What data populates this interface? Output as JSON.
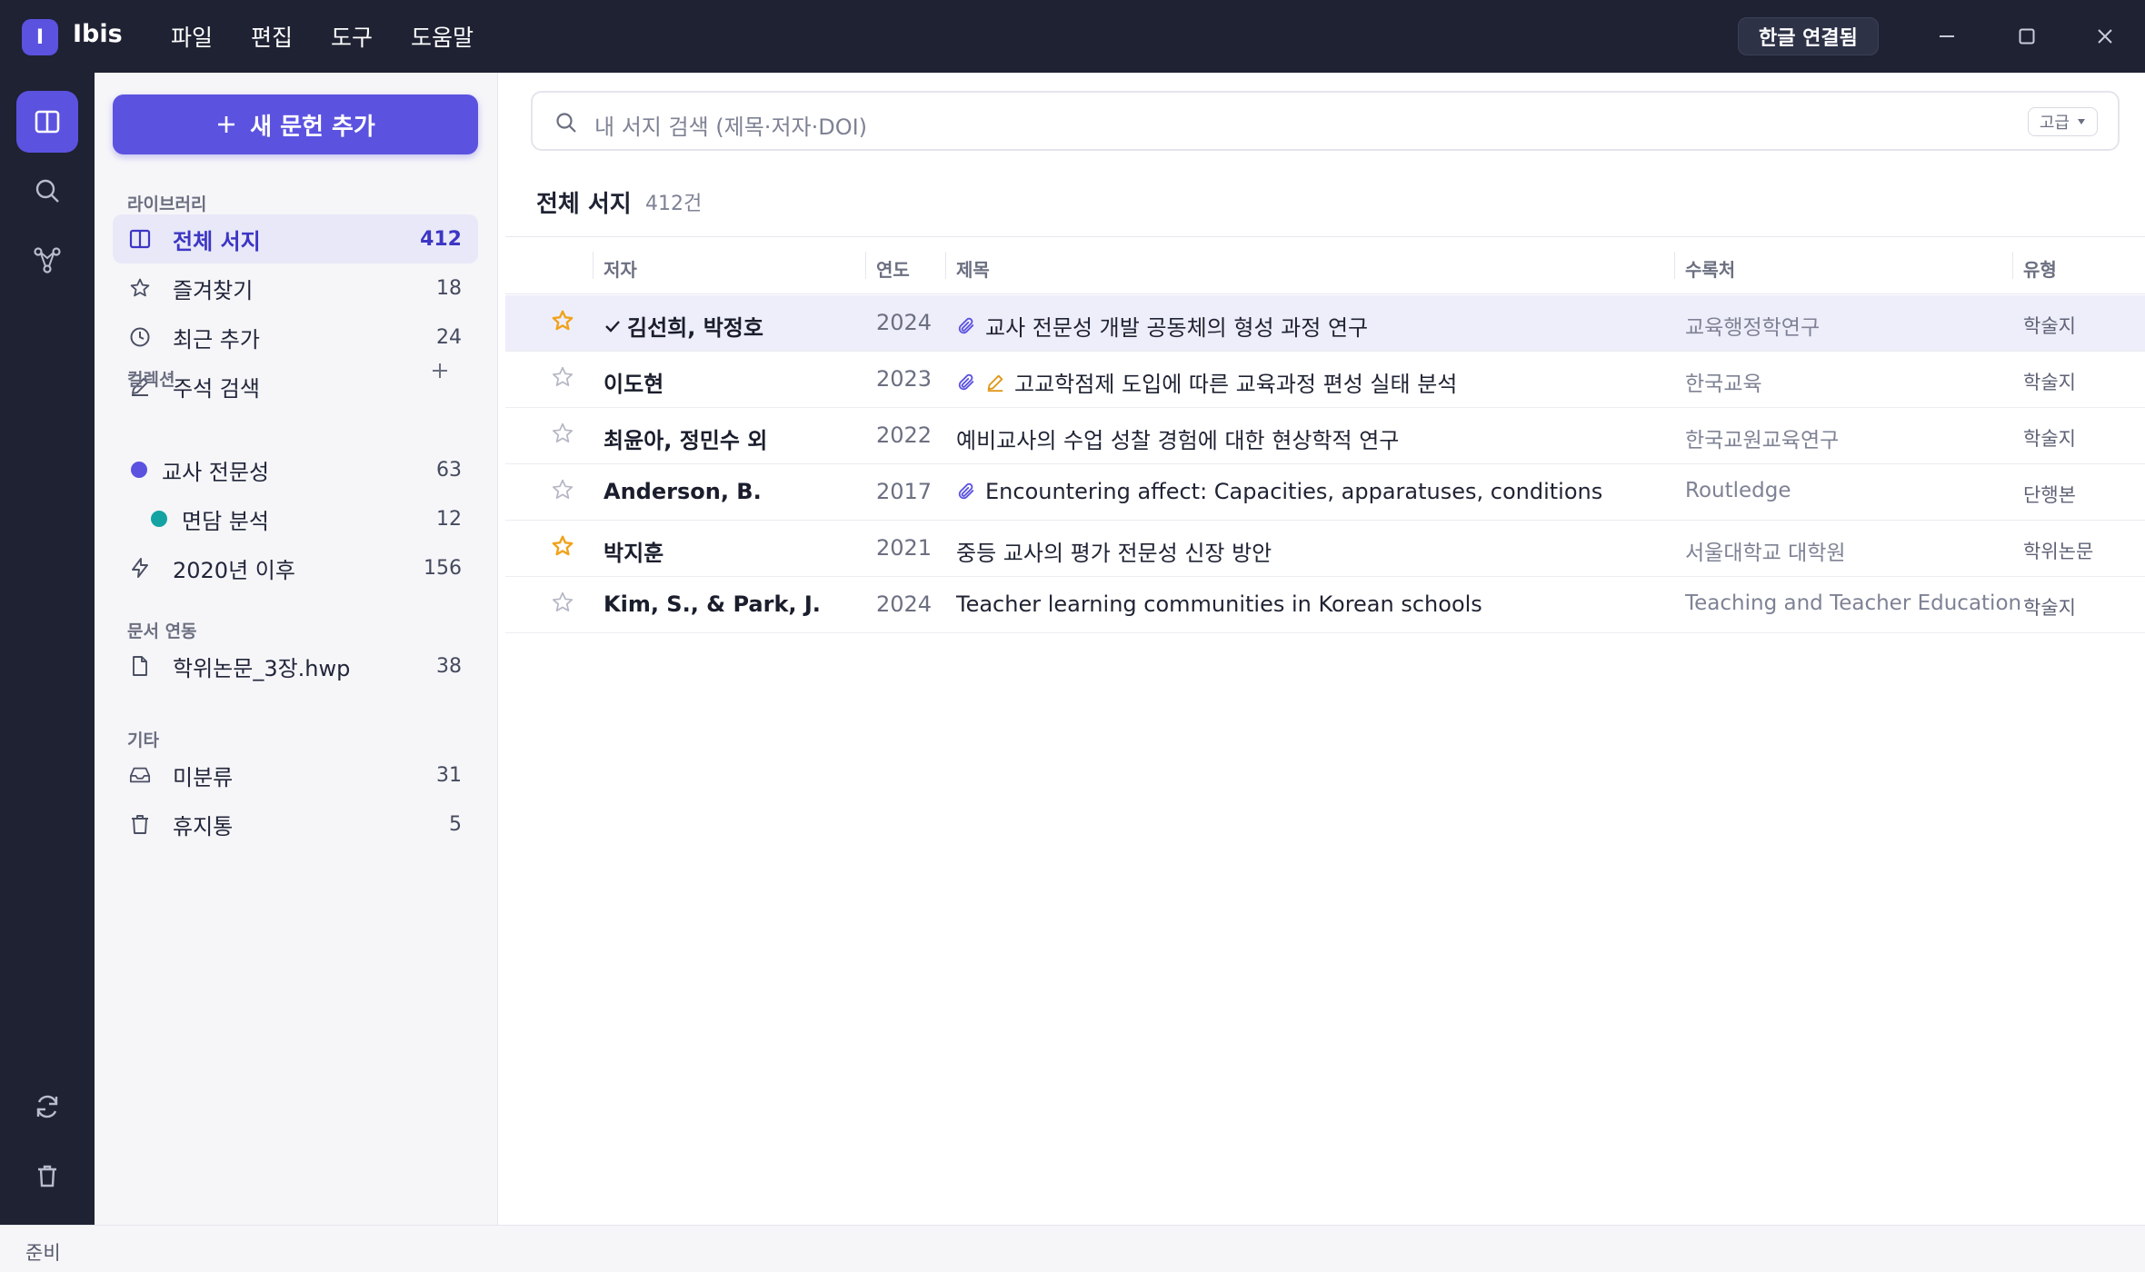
{
  "app": {
    "logo_letter": "I",
    "name": "Ibis"
  },
  "menu": [
    "파일",
    "편집",
    "도구",
    "도움말"
  ],
  "titlebar": {
    "hangul_status": "한글 연결됨"
  },
  "sidebar": {
    "add_button": "새 문헌 추가",
    "library_label": "라이브러리",
    "library": [
      {
        "label": "전체 서지",
        "count": "412",
        "icon": "library-icon",
        "active": true
      },
      {
        "label": "즐겨찾기",
        "count": "18",
        "icon": "star-icon"
      },
      {
        "label": "최근 추가",
        "count": "24",
        "icon": "clock-icon"
      },
      {
        "label": "주석 검색",
        "count": "",
        "icon": "pen-icon"
      }
    ],
    "collections_label": "컬렉션",
    "collections": [
      {
        "label": "교사 전문성",
        "count": "63",
        "color": "#5b52e0"
      },
      {
        "label": "면담 분석",
        "count": "12",
        "color": "#14a3a3"
      },
      {
        "label": "2020년 이후",
        "count": "156",
        "icon": "bolt-icon"
      }
    ],
    "doclink_label": "문서 연동",
    "doclink": [
      {
        "label": "학위논문_3장.hwp",
        "count": "38",
        "icon": "file-icon"
      }
    ],
    "other_label": "기타",
    "other": [
      {
        "label": "미분류",
        "count": "31",
        "icon": "inbox-icon"
      },
      {
        "label": "휴지통",
        "count": "5",
        "icon": "trash-icon"
      }
    ]
  },
  "search": {
    "placeholder": "내 서지 검색 (제목·저자·DOI)",
    "advanced": "고급"
  },
  "list": {
    "title": "전체 서지",
    "count": "412건",
    "columns": {
      "author": "저자",
      "year": "연도",
      "title": "제목",
      "source": "수록처",
      "type": "유형"
    },
    "rows": [
      {
        "starred": true,
        "checked": true,
        "author": "김선희, 박정호",
        "year": "2024",
        "attach": true,
        "note": false,
        "title": "교사 전문성 개발 공동체의 형성 과정 연구",
        "source": "교육행정학연구",
        "type": "학술지",
        "selected": true
      },
      {
        "starred": false,
        "checked": false,
        "author": "이도현",
        "year": "2023",
        "attach": true,
        "note": true,
        "title": "고교학점제 도입에 따른 교육과정 편성 실태 분석",
        "source": "한국교육",
        "type": "학술지"
      },
      {
        "starred": false,
        "checked": false,
        "author": "최윤아, 정민수 외",
        "year": "2022",
        "attach": false,
        "note": false,
        "title": "예비교사의 수업 성찰 경험에 대한 현상학적 연구",
        "source": "한국교원교육연구",
        "type": "학술지"
      },
      {
        "starred": false,
        "checked": false,
        "author": "Anderson, B.",
        "year": "2017",
        "attach": true,
        "note": false,
        "title": "Encountering affect: Capacities, apparatuses, conditions",
        "source": "Routledge",
        "type": "단행본"
      },
      {
        "starred": true,
        "checked": false,
        "author": "박지훈",
        "year": "2021",
        "attach": false,
        "note": false,
        "title": "중등 교사의 평가 전문성 신장 방안",
        "source": "서울대학교 대학원",
        "type": "학위논문"
      },
      {
        "starred": false,
        "checked": false,
        "author": "Kim, S., & Park, J.",
        "year": "2024",
        "attach": false,
        "note": false,
        "title": "Teacher learning communities in Korean schools",
        "source": "Teaching and Teacher Education",
        "type": "학술지"
      }
    ]
  },
  "status": "준비",
  "colors": {
    "accent": "#5b52e0",
    "star": "#f0a21a",
    "dark": "#1f2233"
  }
}
